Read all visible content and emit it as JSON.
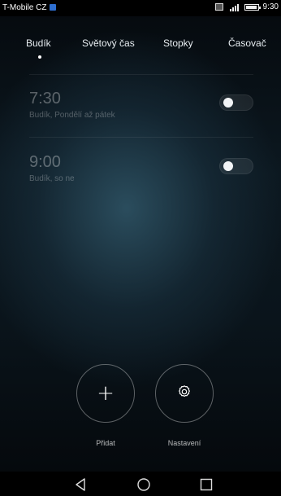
{
  "status_bar": {
    "carrier": "T-Mobile CZ",
    "time": "9:30"
  },
  "tabs": [
    {
      "label": "Budík",
      "active": true
    },
    {
      "label": "Světový čas",
      "active": false
    },
    {
      "label": "Stopky",
      "active": false
    },
    {
      "label": "Časovač",
      "active": false
    }
  ],
  "alarms": [
    {
      "time": "7:30",
      "label": "Budík, Pondělí až pátek",
      "enabled": false
    },
    {
      "time": "9:00",
      "label": "Budík, so ne",
      "enabled": false
    }
  ],
  "actions": {
    "add_label": "Přidat",
    "settings_label": "Nastavení"
  },
  "nav": {
    "back_icon": "back-triangle-icon",
    "home_icon": "home-circle-icon",
    "recents_icon": "recents-square-icon"
  }
}
